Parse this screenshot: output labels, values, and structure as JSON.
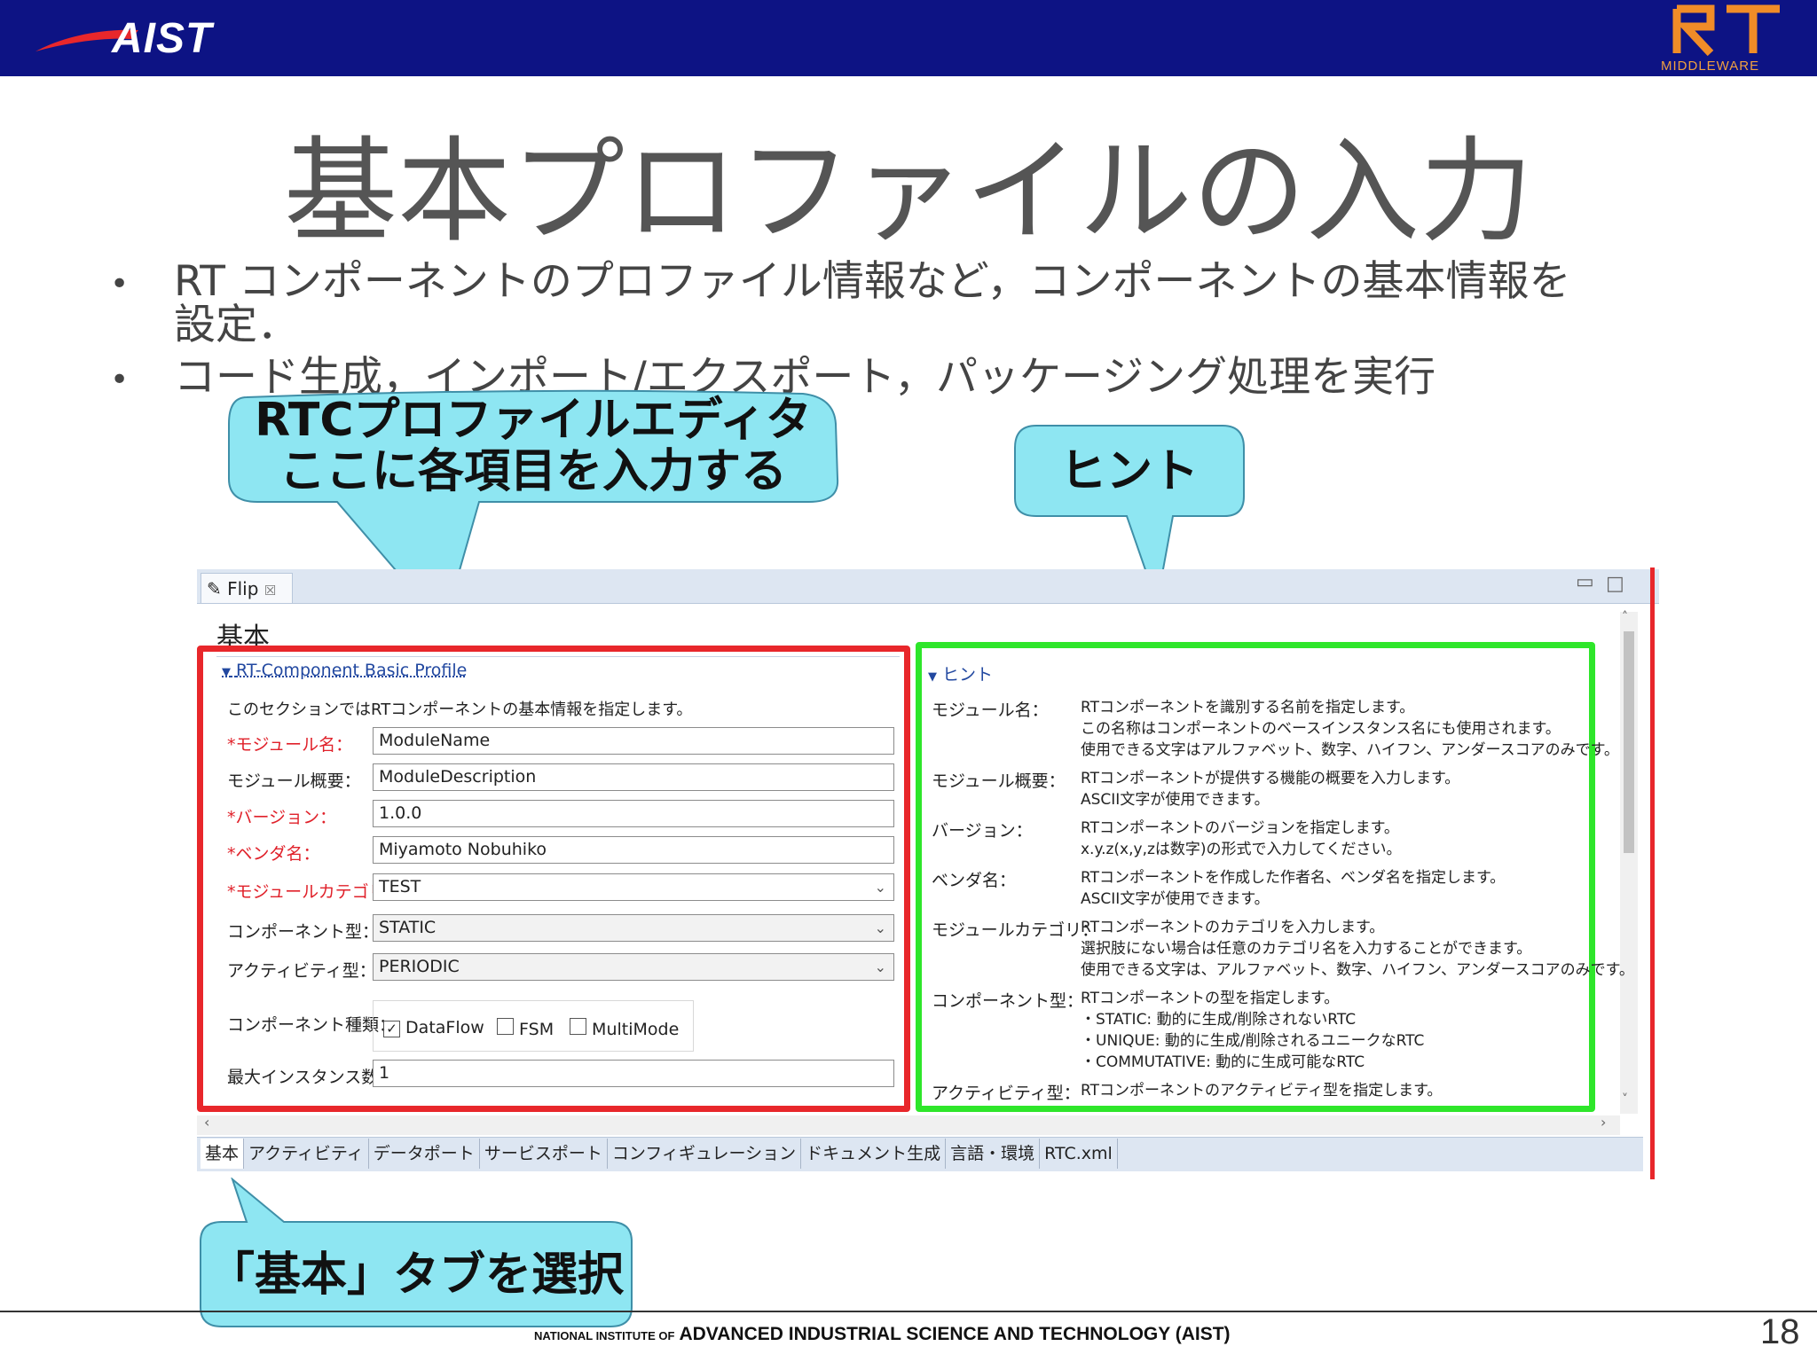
{
  "header": {
    "logo_text": "AIST",
    "rt_logo_caption": "MIDDLEWARE"
  },
  "title": "基本プロファイルの入力",
  "bullets": [
    "RT コンポーネントのプロファイル情報など，コンポーネントの基本情報を",
    "設定．",
    "コード生成，インポート/エクスポート，パッケージング処理を実行"
  ],
  "callouts": {
    "editor_line1": "RTCプロファイルエディタ",
    "editor_line2": "ここに各項目を入力する",
    "hint": "ヒント",
    "select_tab": "「基本」タブを選択"
  },
  "editor": {
    "tab_label": "Flip",
    "tab_close": "☒",
    "heading": "基本",
    "section_title": "RT-Component Basic Profile",
    "section_desc": "このセクションではRTコンポーネントの基本情報を指定します。",
    "fields": [
      {
        "label": "*モジュール名：",
        "value": "ModuleName",
        "required": true,
        "type": "text"
      },
      {
        "label": "モジュール概要：",
        "value": "ModuleDescription",
        "required": false,
        "type": "text"
      },
      {
        "label": "*バージョン：",
        "value": "1.0.0",
        "required": true,
        "type": "text"
      },
      {
        "label": "*ベンダ名：",
        "value": "Miyamoto Nobuhiko",
        "required": true,
        "type": "text"
      },
      {
        "label": "*モジュールカテゴリ：",
        "value": "TEST",
        "required": true,
        "type": "combo"
      },
      {
        "label": "コンポーネント型：",
        "value": "STATIC",
        "required": false,
        "type": "combo"
      },
      {
        "label": "アクティビティ型：",
        "value": "PERIODIC",
        "required": false,
        "type": "combo"
      }
    ],
    "kind_label": "コンポーネント種類：",
    "kind_options": [
      {
        "label": "DataFlow",
        "checked": true
      },
      {
        "label": "FSM",
        "checked": false
      },
      {
        "label": "MultiMode",
        "checked": false
      }
    ],
    "max_instances_label": "最大インスタンス数：",
    "max_instances_value": "1",
    "hint_section_title": "ヒント",
    "hints": [
      {
        "label": "モジュール名：",
        "lines": [
          "RTコンポーネントを識別する名前を指定します。",
          "この名称はコンポーネントのベースインスタンス名にも使用されます。",
          "使用できる文字はアルファベット、数字、ハイフン、アンダースコアのみです。"
        ]
      },
      {
        "label": "モジュール概要：",
        "lines": [
          "RTコンポーネントが提供する機能の概要を入力します。",
          "ASCII文字が使用できます。"
        ]
      },
      {
        "label": "バージョン：",
        "lines": [
          "RTコンポーネントのバージョンを指定します。",
          "x.y.z(x,y,zは数字)の形式で入力してください。"
        ]
      },
      {
        "label": "ベンダ名：",
        "lines": [
          "RTコンポーネントを作成した作者名、ベンダ名を指定します。",
          "ASCII文字が使用できます。"
        ]
      },
      {
        "label": "モジュールカテゴリ：",
        "lines": [
          "RTコンポーネントのカテゴリを入力します。",
          "選択肢にない場合は任意のカテゴリ名を入力することができます。",
          "使用できる文字は、アルファベット、数字、ハイフン、アンダースコアのみです。"
        ]
      },
      {
        "label": "コンポーネント型：",
        "lines": [
          "RTコンポーネントの型を指定します。",
          "・STATIC: 動的に生成/削除されないRTC",
          "・UNIQUE: 動的に生成/削除されるユニークなRTC",
          "・COMMUTATIVE: 動的に生成可能なRTC"
        ]
      },
      {
        "label": "アクティビティ型：",
        "lines": [
          "RTコンポーネントのアクティビティ型を指定します。"
        ]
      }
    ],
    "bottom_tabs": [
      "基本",
      "アクティビティ",
      "データポート",
      "サービスポート",
      "コンフィギュレーション",
      "ドキュメント生成",
      "言語・環境",
      "RTC.xml"
    ],
    "colors": {
      "left_highlight": "#e8272b",
      "right_highlight": "#2ee62a",
      "callout_fill": "#8ee6f2"
    }
  },
  "footer": {
    "small": "NATIONAL INSTITUTE OF",
    "main": "ADVANCED INDUSTRIAL SCIENCE AND TECHNOLOGY (AIST)",
    "page_number": "18"
  }
}
